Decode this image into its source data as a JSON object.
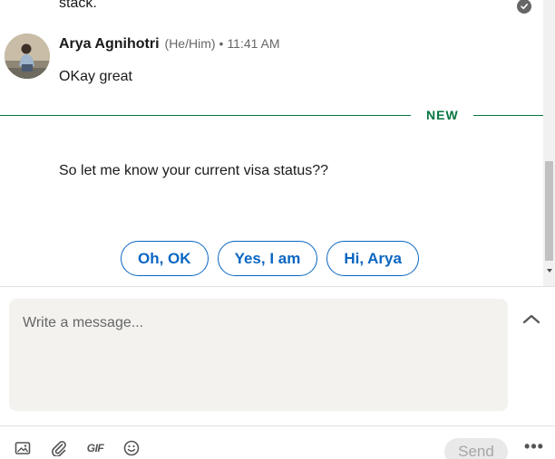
{
  "thread": {
    "previous_message_tail": "stack.",
    "messages": [
      {
        "sender": "Arya Agnihotri",
        "pronouns": "(He/Him)",
        "separator": "•",
        "time": "11:41 AM",
        "text": "OKay great"
      }
    ],
    "new_divider_label": "NEW",
    "new_message_text": "So let me know your current visa status??",
    "quick_replies": [
      "Oh, OK",
      "Yes, I am",
      "Hi, Arya"
    ]
  },
  "composer": {
    "placeholder": "Write a message...",
    "value": ""
  },
  "toolbar": {
    "gif_label": "GIF",
    "send_label": "Send",
    "more_label": "•••"
  },
  "icons": {
    "image": "image-icon",
    "attach": "paperclip-icon",
    "gif": "gif-icon",
    "emoji": "emoji-icon",
    "expand": "chevron-up-icon",
    "seen": "check-circle-icon"
  },
  "colors": {
    "accent": "#0a66c2",
    "new_divider": "#057642",
    "composer_bg": "#f3f2ef"
  }
}
